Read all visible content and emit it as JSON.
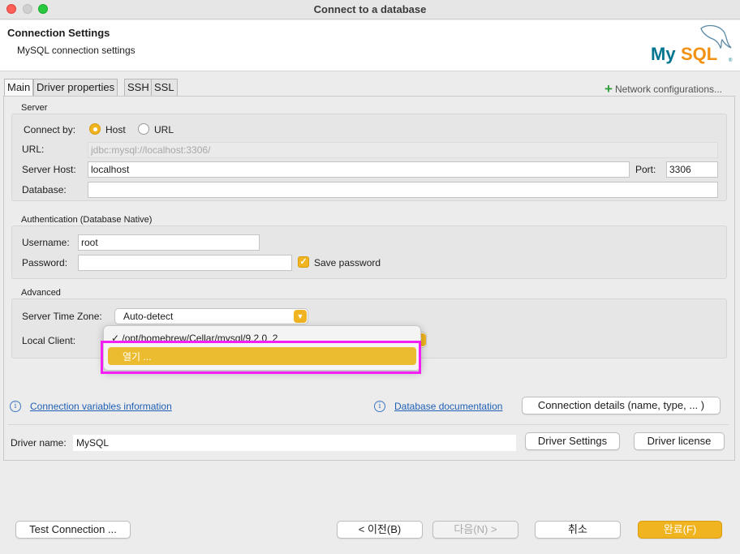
{
  "window": {
    "title": "Connect to a database"
  },
  "header": {
    "title": "Connection Settings",
    "subtitle": "MySQL connection settings",
    "logo_text": "MySQL"
  },
  "tabs": [
    "Main",
    "Driver properties",
    "SSH",
    "SSL"
  ],
  "network_config_label": "Network configurations...",
  "server": {
    "group_label": "Server",
    "connect_by_label": "Connect by:",
    "host_option": "Host",
    "url_option": "URL",
    "url_label": "URL:",
    "url_value": "jdbc:mysql://localhost:3306/",
    "host_label": "Server Host:",
    "host_value": "localhost",
    "port_label": "Port:",
    "port_value": "3306",
    "database_label": "Database:",
    "database_value": ""
  },
  "auth": {
    "group_label": "Authentication (Database Native)",
    "username_label": "Username:",
    "username_value": "root",
    "password_label": "Password:",
    "password_value": "",
    "save_password_label": "Save password"
  },
  "advanced": {
    "group_label": "Advanced",
    "timezone_label": "Server Time Zone:",
    "timezone_value": "Auto-detect",
    "local_client_label": "Local Client:",
    "dropdown_checked_item": "/opt/homebrew/Cellar/mysql/9.2.0_2",
    "dropdown_open_item": "열기 ..."
  },
  "links": {
    "conn_vars": "Connection variables information",
    "db_docs": "Database documentation",
    "conn_details_button": "Connection details (name, type, ... )"
  },
  "driver": {
    "name_label": "Driver name:",
    "name_value": "MySQL",
    "settings_button": "Driver Settings",
    "license_button": "Driver license"
  },
  "footer": {
    "test_button": "Test Connection ...",
    "back_button": "< 이전(B)",
    "next_button": "다음(N) >",
    "cancel_button": "취소",
    "finish_button": "완료(F)"
  },
  "colors": {
    "accent": "#f0b420",
    "highlight": "#f51ef5",
    "link": "#1f5fb4"
  },
  "icons": {
    "network_add": "plus-icon",
    "info": "info-icon",
    "check": "check-icon",
    "select_arrow": "chevron-down-icon"
  }
}
